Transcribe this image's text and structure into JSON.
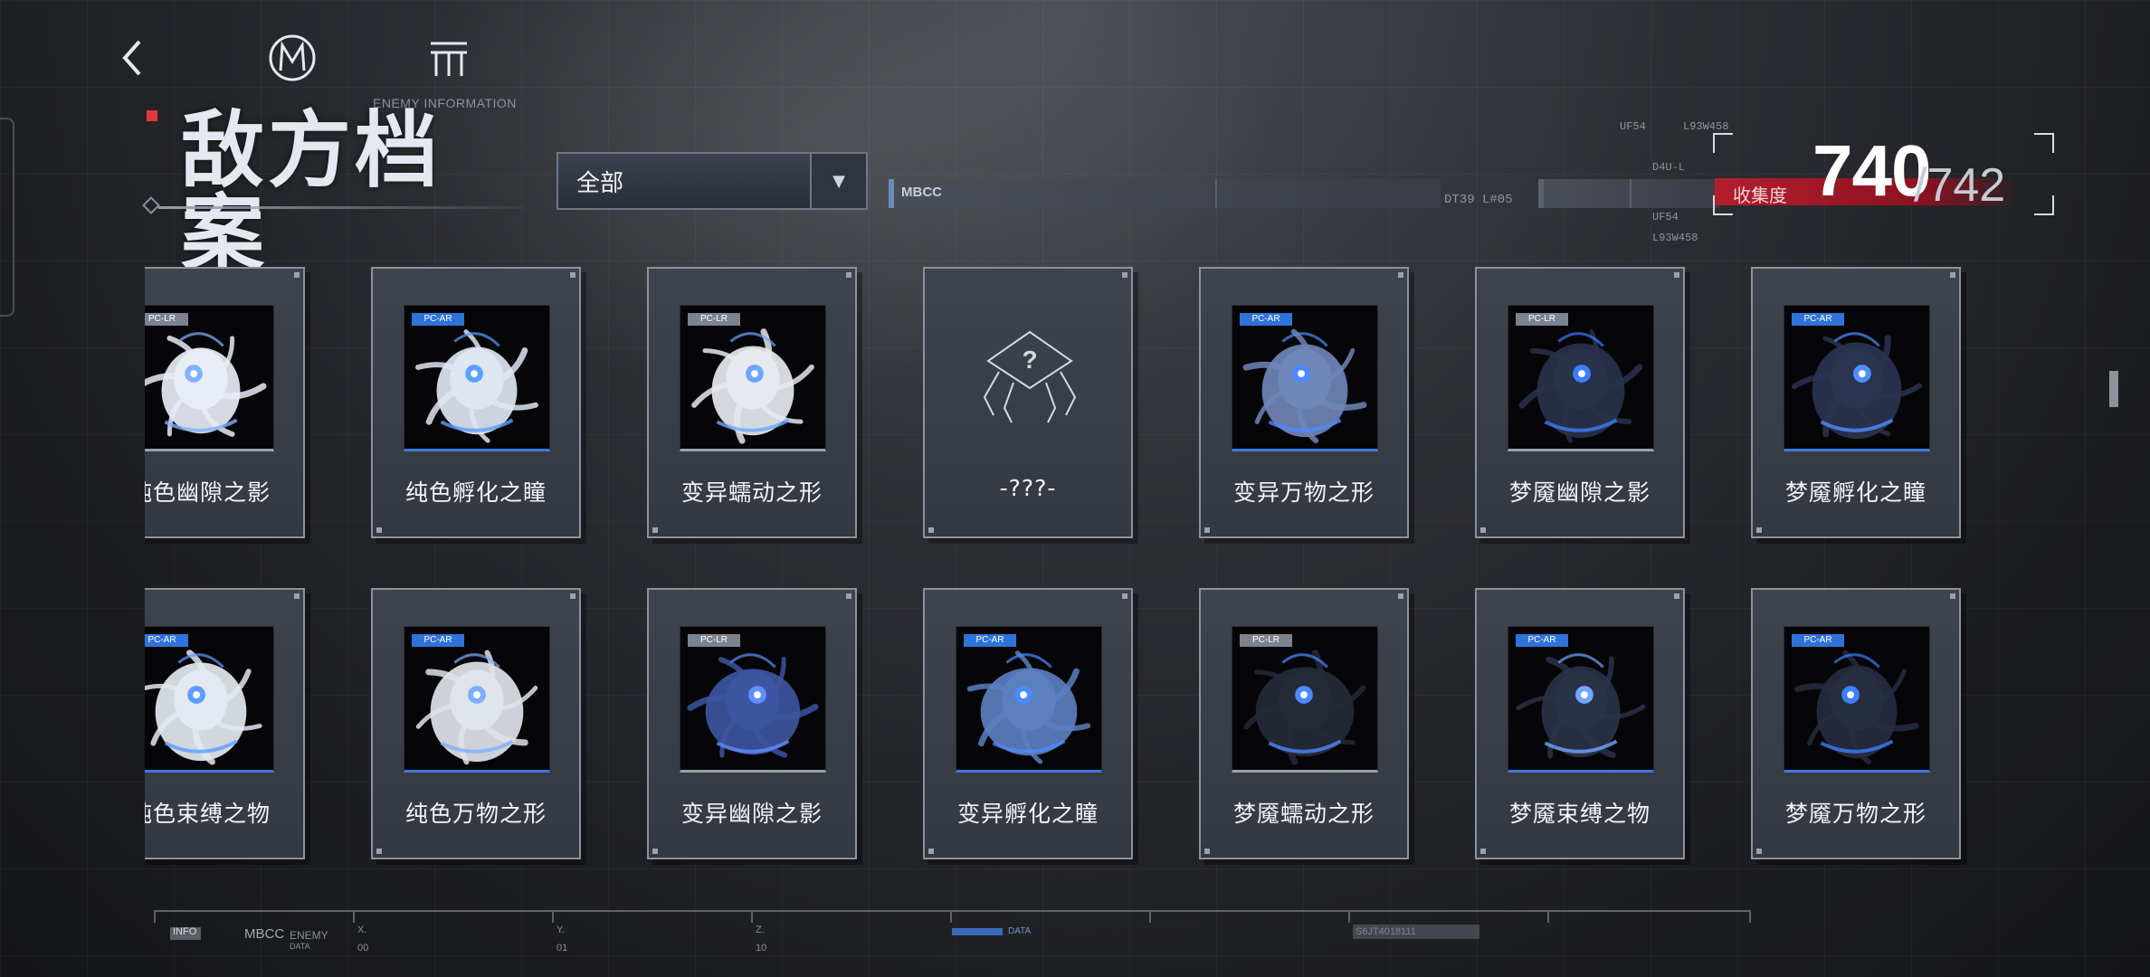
{
  "header": {
    "subtitle": "ENEMY INFORMATION",
    "title": "敌方档案"
  },
  "filter": {
    "selected": "全部"
  },
  "status_bars": {
    "bar1_label": "MBCC",
    "bar1_code": "DT39 L#05",
    "file_tree": [
      "UF54",
      "L93W458",
      "D4U-L",
      "UF54",
      "L93W458"
    ]
  },
  "collection": {
    "label": "收集度",
    "current": "740",
    "total": "/742"
  },
  "enemies": [
    {
      "name": "纯色幽隙之影",
      "tag": "PC-LR",
      "known": true,
      "hue": "#e8ecf4",
      "accent": "#7fb2ff"
    },
    {
      "name": "纯色孵化之瞳",
      "tag": "PC-AR",
      "known": true,
      "hue": "#dfe6f2",
      "accent": "#5aa0ff"
    },
    {
      "name": "变异蠕动之形",
      "tag": "PC-LR",
      "known": true,
      "hue": "#e6e9ef",
      "accent": "#6aa6ff"
    },
    {
      "name": "-???-",
      "tag": "",
      "known": false,
      "hue": "",
      "accent": ""
    },
    {
      "name": "变异万物之形",
      "tag": "PC-AR",
      "known": true,
      "hue": "#6f86b8",
      "accent": "#4c8bff"
    },
    {
      "name": "梦魇幽隙之影",
      "tag": "PC-LR",
      "known": true,
      "hue": "#28324a",
      "accent": "#3d7cff"
    },
    {
      "name": "梦魇孵化之瞳",
      "tag": "PC-AR",
      "known": true,
      "hue": "#2a3450",
      "accent": "#4f8fff"
    },
    {
      "name": "纯色束缚之物",
      "tag": "PC-AR",
      "known": true,
      "hue": "#e4e8f0",
      "accent": "#5d9dff"
    },
    {
      "name": "纯色万物之形",
      "tag": "PC-AR",
      "known": true,
      "hue": "#dfe3ea",
      "accent": "#7ab0ff"
    },
    {
      "name": "变异幽隙之影",
      "tag": "PC-LR",
      "known": true,
      "hue": "#3d55a0",
      "accent": "#5d8fff"
    },
    {
      "name": "变异孵化之瞳",
      "tag": "PC-AR",
      "known": true,
      "hue": "#5c7fc0",
      "accent": "#4c8bff"
    },
    {
      "name": "梦魇蠕动之形",
      "tag": "PC-LR",
      "known": true,
      "hue": "#242a38",
      "accent": "#4c8bff"
    },
    {
      "name": "梦魇束缚之物",
      "tag": "PC-AR",
      "known": true,
      "hue": "#2a3248",
      "accent": "#6fa7ff"
    },
    {
      "name": "梦魇万物之形",
      "tag": "PC-AR",
      "known": true,
      "hue": "#262d3f",
      "accent": "#3f7eff"
    }
  ],
  "footer": {
    "info": "INFO",
    "mbcc": "MBCC",
    "enemy": "ENEMY",
    "data": "DATA",
    "x_label": "X.",
    "x_val": "00",
    "y_label": "Y.",
    "y_val": "01",
    "z_label": "Z.",
    "z_val": "10",
    "data2": "DATA",
    "code": "S6JT4018111"
  },
  "colors": {
    "accent_blue": "#2f73d8",
    "accent_red": "#b41e2d",
    "card_border": "#8b929e"
  },
  "icons": [
    "back-icon",
    "mbcc-logo-icon",
    "menu-icon",
    "dropdown-arrow-icon",
    "unknown-enemy-icon"
  ]
}
